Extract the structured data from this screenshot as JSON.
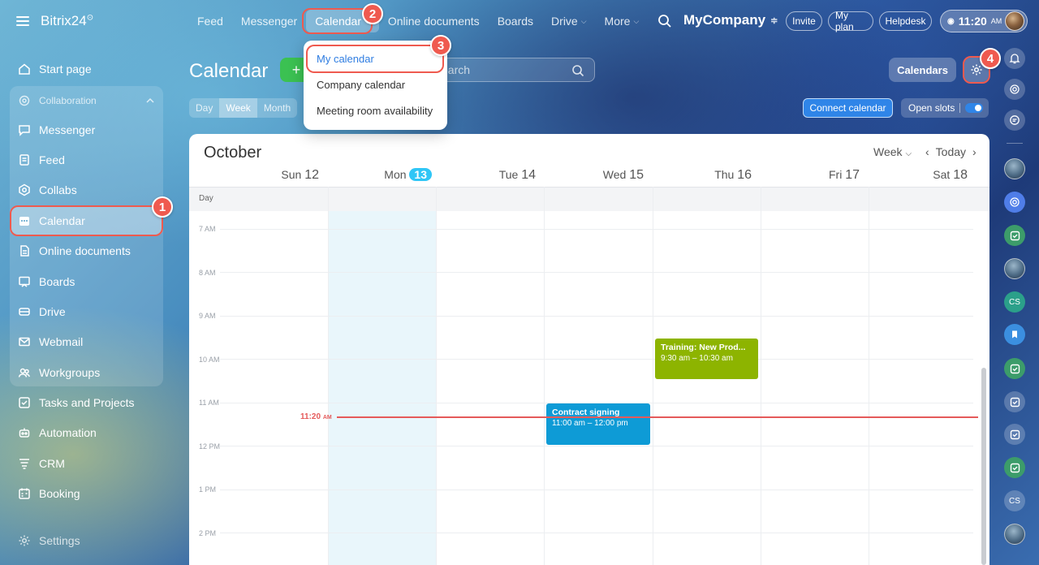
{
  "brand": {
    "name": "Bitrix24",
    "mark": "⊙"
  },
  "sidebar": {
    "items": [
      {
        "label": "Start page",
        "icon": "home-icon"
      },
      {
        "label": "Messenger",
        "icon": "chat-icon"
      },
      {
        "label": "Feed",
        "icon": "feed-icon"
      },
      {
        "label": "Collabs",
        "icon": "collabs-icon"
      },
      {
        "label": "Calendar",
        "icon": "calendar-icon"
      },
      {
        "label": "Online documents",
        "icon": "document-icon"
      },
      {
        "label": "Boards",
        "icon": "board-icon"
      },
      {
        "label": "Drive",
        "icon": "drive-icon"
      },
      {
        "label": "Webmail",
        "icon": "mail-icon"
      },
      {
        "label": "Workgroups",
        "icon": "group-icon"
      },
      {
        "label": "Tasks and Projects",
        "icon": "tasks-icon"
      },
      {
        "label": "Automation",
        "icon": "robot-icon"
      },
      {
        "label": "CRM",
        "icon": "crm-icon"
      },
      {
        "label": "Booking",
        "icon": "booking-icon"
      },
      {
        "label": "Settings",
        "icon": "gear-icon"
      }
    ],
    "group_label": "Collaboration"
  },
  "topnav": {
    "items": [
      "Feed",
      "Messenger",
      "Calendar",
      "Online documents",
      "Boards",
      "Drive",
      "More"
    ],
    "company": "MyCompany",
    "invite": "Invite",
    "my_plan": "My plan",
    "helpdesk": "Helpdesk",
    "time": "11:20",
    "time_suffix": "AM"
  },
  "dropdown": {
    "items": [
      "My calendar",
      "Company calendar",
      "Meeting room availability"
    ]
  },
  "page": {
    "title": "Calendar",
    "add": "+",
    "search_placeholder": "earch",
    "calendars_btn": "Calendars",
    "views": [
      "Day",
      "Week",
      "Month"
    ],
    "connect_btn": "Connect calendar",
    "slots_btn": "Open slots"
  },
  "calendar": {
    "month": "October",
    "view_select": "Week",
    "today": "Today",
    "allday_label": "Day",
    "days": [
      {
        "name": "Sun",
        "num": "12"
      },
      {
        "name": "Mon",
        "num": "13"
      },
      {
        "name": "Tue",
        "num": "14"
      },
      {
        "name": "Wed",
        "num": "15"
      },
      {
        "name": "Thu",
        "num": "16"
      },
      {
        "name": "Fri",
        "num": "17"
      },
      {
        "name": "Sat",
        "num": "18"
      }
    ],
    "hours": [
      "7 AM",
      "8 AM",
      "9 AM",
      "10 AM",
      "11 AM",
      "12 PM",
      "1 PM",
      "2 PM"
    ],
    "events": [
      {
        "title": "Training: New Prod...",
        "time": "9:30 am – 10:30 am",
        "color": "#8db400"
      },
      {
        "title": "Contract signing",
        "time": "11:00 am – 12:00 pm",
        "color": "#0e9bd6"
      }
    ],
    "now_time": "11:20",
    "now_suffix": "AM"
  },
  "annotations": [
    "1",
    "2",
    "3",
    "4"
  ],
  "rail": {
    "initials_1": "CS",
    "initials_2": "CS"
  }
}
